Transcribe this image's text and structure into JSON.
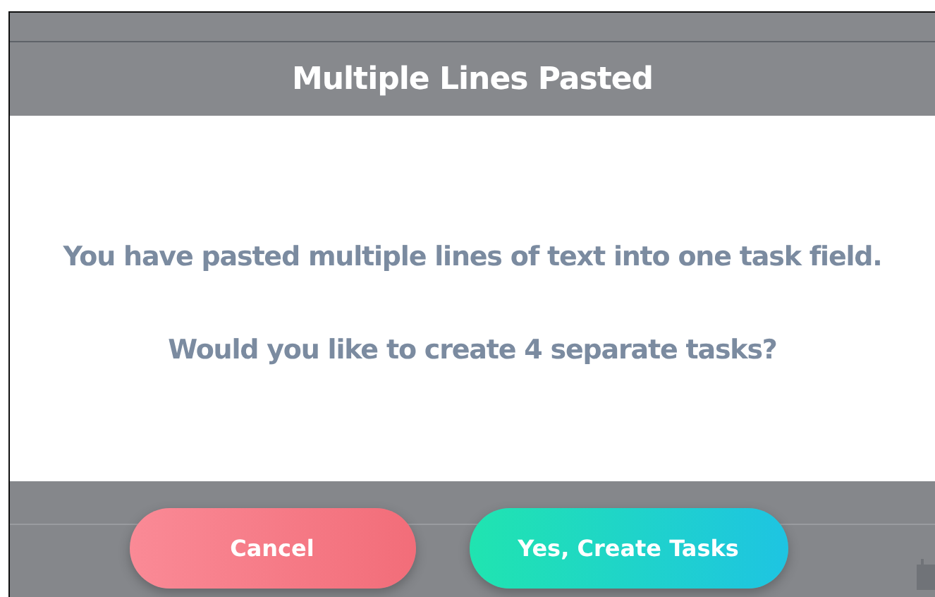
{
  "dialog": {
    "title": "Multiple Lines Pasted",
    "messages": [
      "You have pasted multiple lines of text into one task field.",
      "Would you like to create 4 separate tasks?"
    ],
    "buttons": [
      {
        "label": "Cancel",
        "kind": "cancel"
      },
      {
        "label": "Yes, Create Tasks",
        "kind": "confirm"
      }
    ]
  }
}
